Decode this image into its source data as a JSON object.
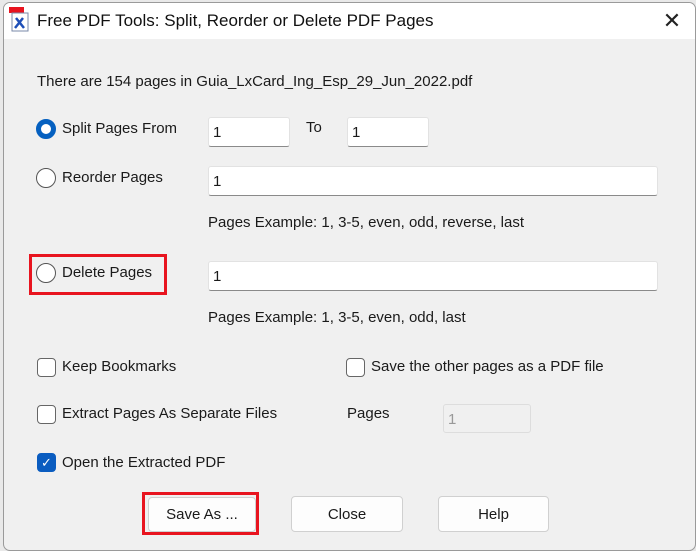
{
  "window": {
    "title": "Free PDF Tools: Split, Reorder or Delete PDF Pages",
    "close_icon": "close-icon"
  },
  "info": "There are 154 pages in Guia_LxCard_Ing_Esp_29_Jun_2022.pdf",
  "split": {
    "label": "Split Pages From",
    "from": "1",
    "to_label": "To",
    "to": "1",
    "selected": true
  },
  "reorder": {
    "label": "Reorder Pages",
    "value": "1",
    "example": "Pages Example: 1, 3-5, even, odd, reverse, last",
    "selected": false
  },
  "delete": {
    "label": "Delete Pages",
    "value": "1",
    "example": "Pages Example: 1, 3-5, even, odd, last",
    "selected": false
  },
  "options": {
    "keep_bookmarks": {
      "label": "Keep Bookmarks",
      "checked": false
    },
    "save_other": {
      "label": "Save the other pages as a PDF file",
      "checked": false
    },
    "extract_separate": {
      "label": "Extract Pages As Separate Files",
      "checked": false
    },
    "pages_label": "Pages",
    "pages_value": "1",
    "open_extracted": {
      "label": "Open the Extracted PDF",
      "checked": true
    }
  },
  "buttons": {
    "save_as": "Save As ...",
    "close": "Close",
    "help": "Help"
  },
  "highlight_color": "#e8141f",
  "accent": "#0560c0"
}
